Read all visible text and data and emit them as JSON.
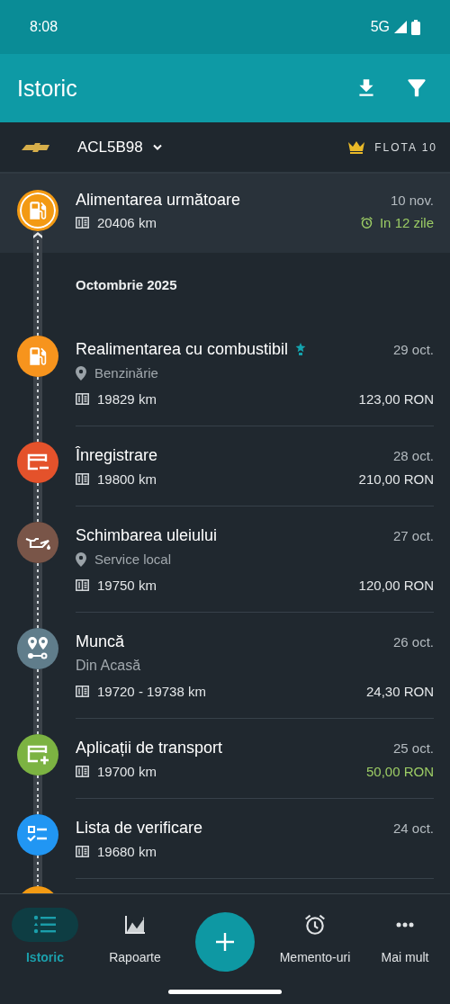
{
  "status_bar": {
    "time": "8:08",
    "network": "5G"
  },
  "app_bar": {
    "title": "Istoric"
  },
  "vehicle": {
    "plate": "ACL5B98",
    "plan": "FLOTA 10"
  },
  "upcoming": {
    "kind": "fuel",
    "color": "#f39a13",
    "title": "Alimentarea următoare",
    "odometer": "20406 km",
    "date": "10 nov.",
    "due": "In 12 zile"
  },
  "month": "Octombrie 2025",
  "entries": [
    {
      "kind": "fuel",
      "color": "#f7941d",
      "title": "Realimentarea cu combustibil",
      "starred": true,
      "place": "Benzinărie",
      "odometer": "19829 km",
      "date": "29 oct.",
      "cost": "123,00 RON",
      "income": false
    },
    {
      "kind": "expense",
      "color": "#e4522b",
      "title": "Înregistrare",
      "starred": false,
      "odometer": "19800 km",
      "date": "28 oct.",
      "cost": "210,00 RON",
      "income": false
    },
    {
      "kind": "oil",
      "color": "#795548",
      "title": "Schimbarea uleiului",
      "starred": false,
      "place": "Service local",
      "odometer": "19750 km",
      "date": "27 oct.",
      "cost": "120,00 RON",
      "income": false
    },
    {
      "kind": "route",
      "color": "#607d8b",
      "title": "Muncă",
      "starred": false,
      "note": "Din Acasă",
      "odometer": "19720 - 19738 km",
      "date": "26 oct.",
      "cost": "24,30 RON",
      "income": false
    },
    {
      "kind": "income",
      "color": "#7cb342",
      "title": "Aplicații de transport",
      "starred": false,
      "odometer": "19700 km",
      "date": "25 oct.",
      "cost": "50,00 RON",
      "income": true
    },
    {
      "kind": "checklist",
      "color": "#2196f3",
      "title": "Lista de verificare",
      "starred": false,
      "odometer": "19680 km",
      "date": "24 oct."
    }
  ],
  "peek": {
    "color": "#f39a13"
  },
  "nav": [
    {
      "label": "Istoric",
      "selected": true
    },
    {
      "label": "Rapoarte",
      "selected": false
    },
    {
      "label": "Memento-uri",
      "selected": false
    },
    {
      "label": "Mai mult",
      "selected": false
    }
  ]
}
